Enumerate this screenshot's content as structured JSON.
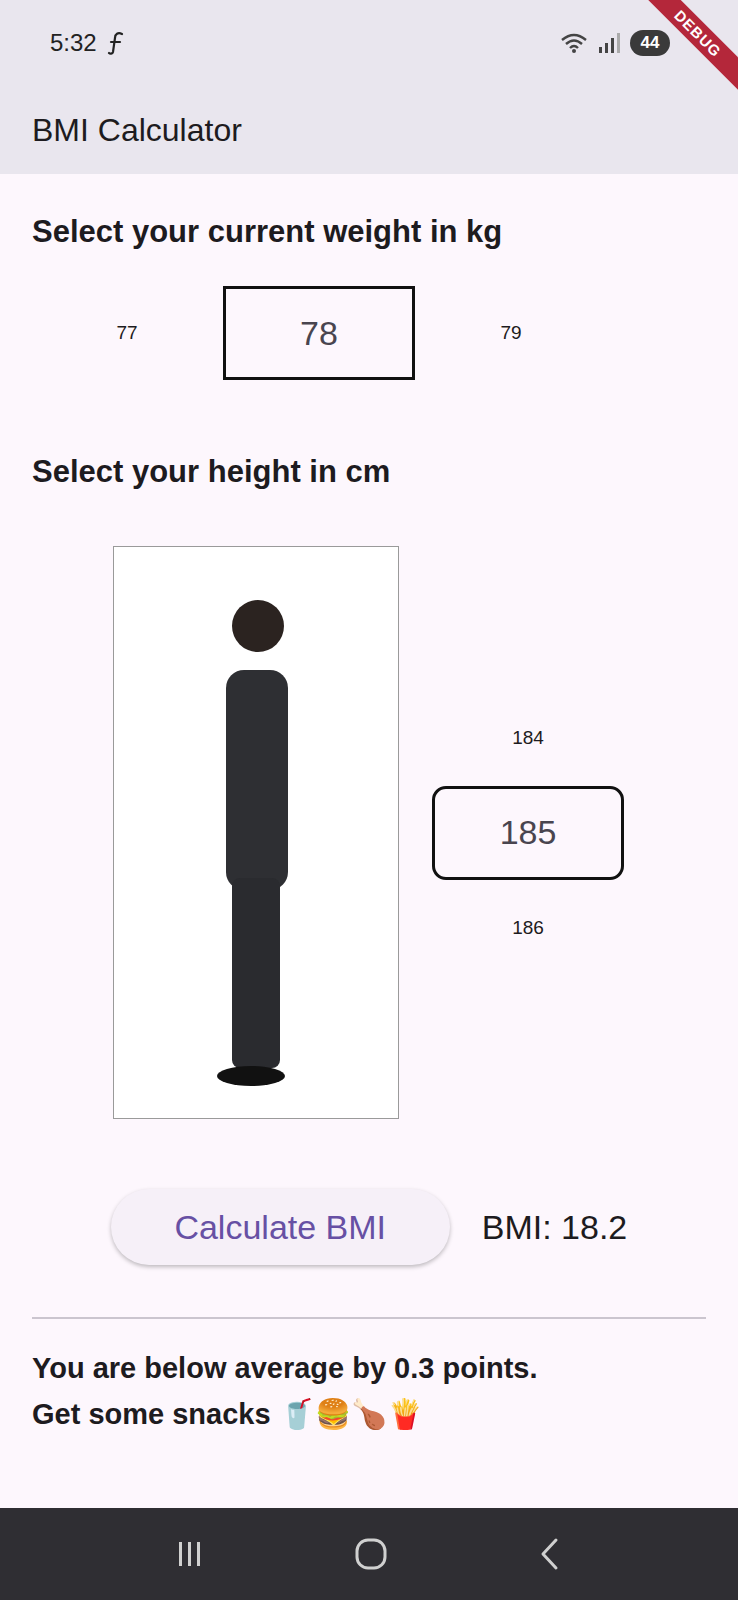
{
  "status_bar": {
    "time": "5:32",
    "battery": "44"
  },
  "debug_banner": "DEBUG",
  "app_bar": {
    "title": "BMI Calculator"
  },
  "weight": {
    "label": "Select your current weight in kg",
    "options": [
      {
        "value": "77",
        "selected": false
      },
      {
        "value": "78",
        "selected": true
      },
      {
        "value": "79",
        "selected": false
      }
    ]
  },
  "height": {
    "label": "Select your height in cm",
    "options": [
      {
        "value": "184",
        "selected": false
      },
      {
        "value": "185",
        "selected": true
      },
      {
        "value": "186",
        "selected": false
      }
    ]
  },
  "calculate_button": {
    "label": "Calculate BMI"
  },
  "result": {
    "text": "BMI: 18.2"
  },
  "message": {
    "lines": [
      "You are below average by 0.3 points.",
      "Get some snacks 🥤🍔🍗🍟"
    ]
  }
}
